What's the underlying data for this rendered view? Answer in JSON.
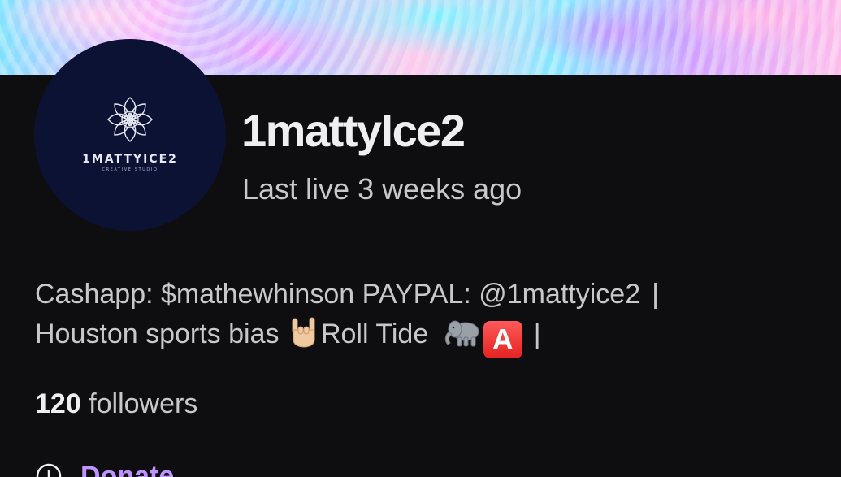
{
  "profile": {
    "avatar_text": "1MATTYICE2",
    "avatar_subtext": "CREATIVE STUDIO",
    "display_name": "1mattyIce2",
    "last_live": "Last live 3 weeks ago"
  },
  "bio": {
    "line1": "Cashapp: $mathewhinson PAYPAL: @1mattyice2",
    "separator": "|",
    "line2_part1": "Houston sports bias",
    "line2_part2": "Roll Tide",
    "emoji_a": "A"
  },
  "followers": {
    "count": "120",
    "label": "followers"
  },
  "donate": {
    "label": "Donate"
  },
  "colors": {
    "background": "#0e0e10",
    "accent": "#bf94ff",
    "avatar_bg": "#0b1233"
  }
}
